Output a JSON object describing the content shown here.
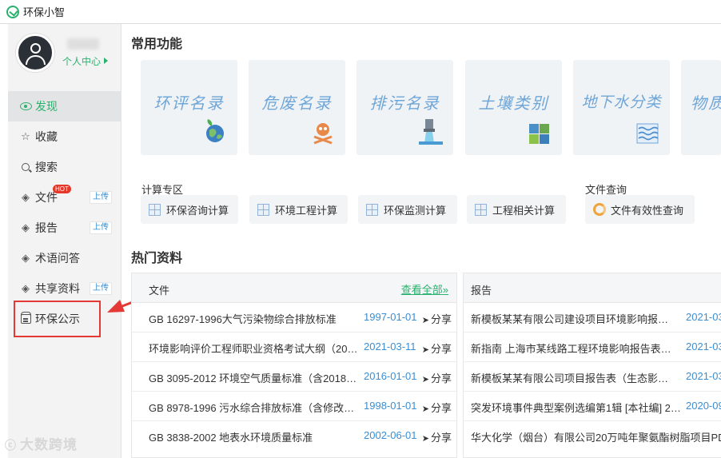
{
  "window": {
    "title": "环保小智"
  },
  "sidebar": {
    "profile": {
      "link_label": "个人中心"
    },
    "items": [
      {
        "label": "发现",
        "icon": "eye-icon",
        "active": true,
        "badge": ""
      },
      {
        "label": "收藏",
        "icon": "star-icon",
        "active": false,
        "badge": ""
      },
      {
        "label": "搜索",
        "icon": "search-icon",
        "active": false,
        "badge": ""
      },
      {
        "label": "文件",
        "icon": "layers-icon",
        "active": false,
        "badge": "上传",
        "hot": "HOT"
      },
      {
        "label": "报告",
        "icon": "layers-icon",
        "active": false,
        "badge": "上传"
      },
      {
        "label": "术语问答",
        "icon": "layers-icon",
        "active": false,
        "badge": ""
      },
      {
        "label": "共享资料",
        "icon": "layers-icon",
        "active": false,
        "badge": "上传"
      },
      {
        "label": "环保公示",
        "icon": "notice-icon",
        "active": false,
        "badge": ""
      }
    ]
  },
  "common": {
    "title": "常用功能",
    "cards": [
      {
        "label": "环评名录",
        "icon": "globe-leaf-icon"
      },
      {
        "label": "危废名录",
        "icon": "hazard-skull-icon"
      },
      {
        "label": "排污名录",
        "icon": "discharge-pipe-icon"
      },
      {
        "label": "土壤类别",
        "icon": "soil-grid-icon"
      },
      {
        "label": "地下水分类",
        "icon": "water-waves-icon"
      },
      {
        "label": "物质",
        "icon": "substance-icon"
      }
    ]
  },
  "calc": {
    "title": "计算专区",
    "buttons": [
      "环保咨询计算",
      "环境工程计算",
      "环保监测计算",
      "工程相关计算"
    ]
  },
  "file_query": {
    "title": "文件查询",
    "button": "文件有效性查询"
  },
  "hot": {
    "title": "热门资料",
    "files": {
      "header": "文件",
      "view_all": "查看全部",
      "share_label": "分享",
      "rows": [
        {
          "name": "GB 16297-1996大气污染物综合排放标准",
          "date": "1997-01-01"
        },
        {
          "name": "环境影响评价工程师职业资格考试大纲（202…",
          "date": "2021-03-11"
        },
        {
          "name": "GB 3095-2012 环境空气质量标准（含2018…",
          "date": "2016-01-01"
        },
        {
          "name": "GB 8978-1996 污水综合排放标准（含修改…",
          "date": "1998-01-01"
        },
        {
          "name": "GB 3838-2002 地表水环境质量标准",
          "date": "2002-06-01"
        }
      ]
    },
    "reports": {
      "header": "报告",
      "rows": [
        {
          "name": "新模板某某有限公司建设项目环境影响报告…",
          "date": "2021-03"
        },
        {
          "name": "新指南 上海市某线路工程环境影响报告表（…",
          "date": "2021-03"
        },
        {
          "name": "新模板某某有限公司项目报告表（生态影响…",
          "date": "2021-03"
        },
        {
          "name": "突发环境事件典型案例选编第1辑 [本社编] 2…",
          "date": "2020-09"
        },
        {
          "name": "华大化学（烟台）有限公司20万吨年聚氨酯树脂项目PD",
          "date": ""
        }
      ]
    }
  },
  "watermark": "大数跨境",
  "colors": {
    "accent": "#2ab16e",
    "link": "#3b8ed2",
    "highlight": "#e53935",
    "card_text": "#6fa6d8"
  }
}
